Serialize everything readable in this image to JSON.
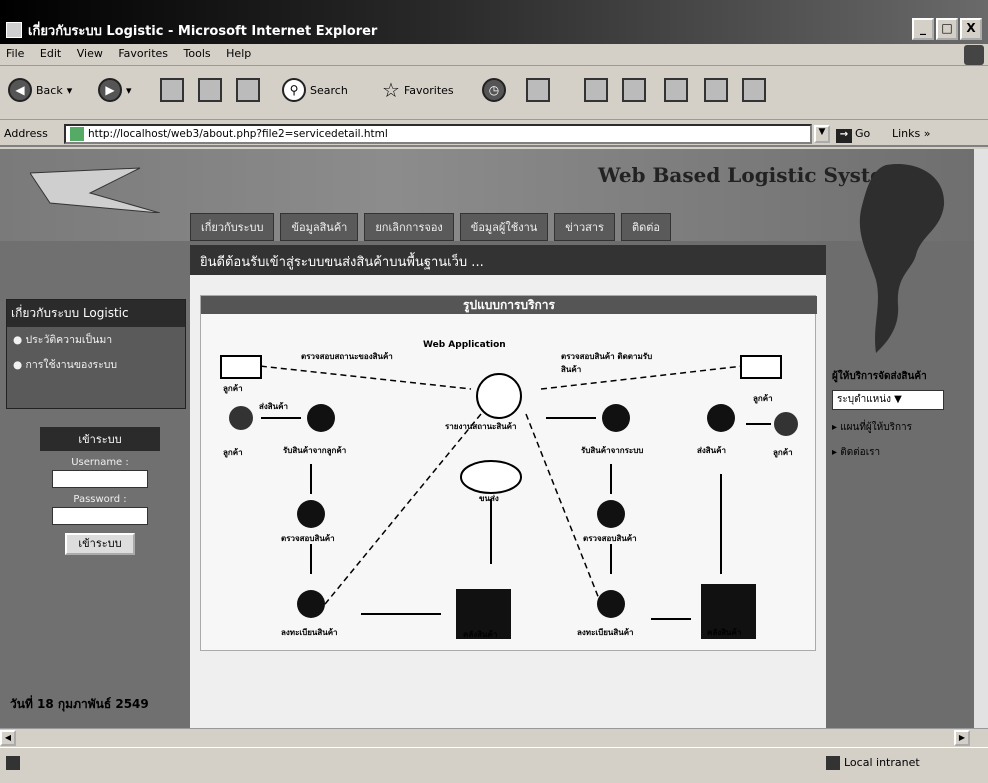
{
  "window": {
    "title": "เกี่ยวกับระบบ Logistic - Microsoft Internet Explorer",
    "buttons": {
      "minimize": "_",
      "maximize": "□",
      "close": "X"
    }
  },
  "menubar": {
    "items": [
      "File",
      "Edit",
      "View",
      "Favorites",
      "Tools",
      "Help"
    ]
  },
  "toolbar": {
    "back": "Back",
    "search": "Search",
    "favorites": "Favorites"
  },
  "address": {
    "label": "Address",
    "url": "http://localhost/web3/about.php?file2=servicedetail.html",
    "go": "Go",
    "links": "Links"
  },
  "site": {
    "title": "Web Based Logistic Systems",
    "nav": [
      "เกี่ยวกับระบบ",
      "ข้อมูลสินค้า",
      "ยกเลิกการจอง",
      "ข้อมูลผู้ใช้งาน",
      "ข่าวสาร",
      "ติดต่อ"
    ],
    "welcome": "ยินดีต้อนรับเข้าสู่ระบบขนส่งสินค้าบนพื้นฐานเว็บ ..."
  },
  "sidebar": {
    "header": "เกี่ยวกับระบบ Logistic",
    "items": [
      "ประวัติความเป็นมา",
      "การใช้งานของระบบ"
    ],
    "login": {
      "header": "เข้าระบบ",
      "username_label": "Username :",
      "password_label": "Password :",
      "button": "เข้าระบบ"
    },
    "date": "วันที่ 18 กุมภาพันธ์ 2549"
  },
  "diagram": {
    "title": "รูปแบบการบริการ",
    "labels": {
      "web_app": "Web Application",
      "check_left": "ตรวจสอบสถานะของสินค้า",
      "check_right": "ตรวจสอบสินค้า ติดตามรับสินค้า",
      "customer_tl": "ลูกค้า",
      "customer_tr": "ลูกค้า",
      "customer_l": "ลูกค้า",
      "customer_r": "ลูกค้า",
      "send": "ส่งสินค้า",
      "receive_from_customer": "รับสินค้าจากลูกค้า",
      "report": "รายงานสถานะสินค้า",
      "receive_from_system": "รับสินค้าจากระบบ",
      "deliver": "ส่งสินค้า",
      "transport": "ขนส่ง",
      "check_goods_l": "ตรวจสอบสินค้า",
      "check_goods_r": "ตรวจสอบสินค้า",
      "register_l": "ลงทะเบียนสินค้า",
      "register_r": "ลงทะเบียนสินค้า",
      "store_l": "คลังสินค้า",
      "store_r": "คลังสินค้า"
    }
  },
  "rightbar": {
    "header": "ผู้ให้บริการจัดส่งสินค้า",
    "select": "ระบุตำแหน่ง",
    "links": [
      "แผนที่ผู้ให้บริการ",
      "ติดต่อเรา"
    ]
  },
  "statusbar": {
    "zone": "Local intranet"
  }
}
